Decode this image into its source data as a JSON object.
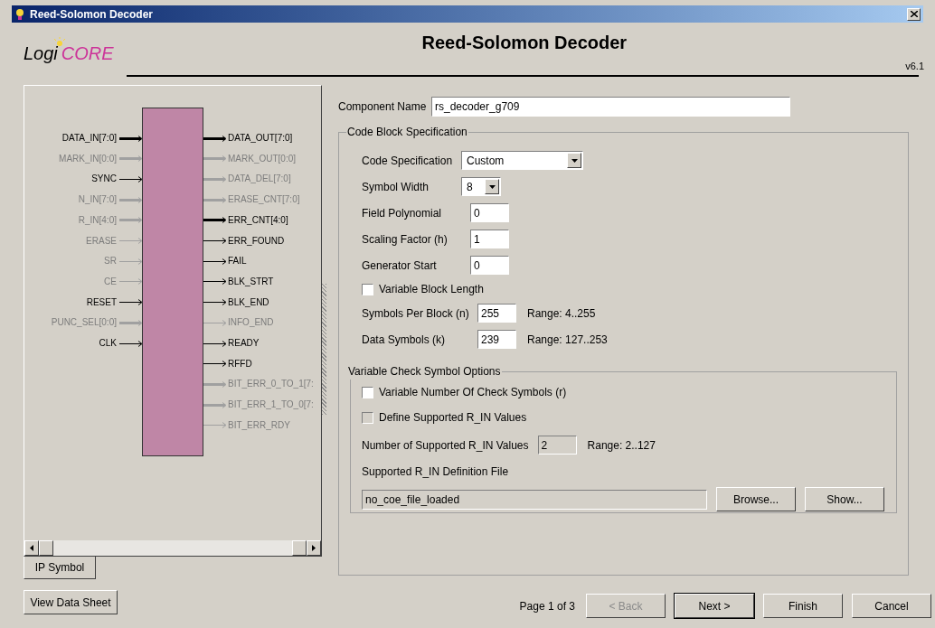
{
  "window": {
    "title": "Reed-Solomon Decoder"
  },
  "header": {
    "logo_prefix": "Logi",
    "logo_suffix": "CORE",
    "title": "Reed-Solomon Decoder",
    "version": "v6.1"
  },
  "symbol": {
    "inputs": [
      {
        "label": "DATA_IN[7:0]",
        "bus": true,
        "enabled": true
      },
      {
        "label": "MARK_IN[0:0]",
        "bus": true,
        "enabled": false
      },
      {
        "label": "SYNC",
        "bus": false,
        "enabled": true
      },
      {
        "label": "N_IN[7:0]",
        "bus": true,
        "enabled": false
      },
      {
        "label": "R_IN[4:0]",
        "bus": true,
        "enabled": false
      },
      {
        "label": "ERASE",
        "bus": false,
        "enabled": false
      },
      {
        "label": "SR",
        "bus": false,
        "enabled": false
      },
      {
        "label": "CE",
        "bus": false,
        "enabled": false
      },
      {
        "label": "RESET",
        "bus": false,
        "enabled": true
      },
      {
        "label": "PUNC_SEL[0:0]",
        "bus": true,
        "enabled": false
      },
      {
        "label": "CLK",
        "bus": false,
        "enabled": true
      }
    ],
    "outputs": [
      {
        "label": "DATA_OUT[7:0]",
        "bus": true,
        "enabled": true
      },
      {
        "label": "MARK_OUT[0:0]",
        "bus": true,
        "enabled": false
      },
      {
        "label": "DATA_DEL[7:0]",
        "bus": true,
        "enabled": false
      },
      {
        "label": "ERASE_CNT[7:0]",
        "bus": true,
        "enabled": false
      },
      {
        "label": "ERR_CNT[4:0]",
        "bus": true,
        "enabled": true
      },
      {
        "label": "ERR_FOUND",
        "bus": false,
        "enabled": true
      },
      {
        "label": "FAIL",
        "bus": false,
        "enabled": true
      },
      {
        "label": "BLK_STRT",
        "bus": false,
        "enabled": true
      },
      {
        "label": "BLK_END",
        "bus": false,
        "enabled": true
      },
      {
        "label": "INFO_END",
        "bus": false,
        "enabled": false
      },
      {
        "label": "READY",
        "bus": false,
        "enabled": true
      },
      {
        "label": "RFFD",
        "bus": false,
        "enabled": true
      },
      {
        "label": "BIT_ERR_0_TO_1[7:",
        "bus": true,
        "enabled": false
      },
      {
        "label": "BIT_ERR_1_TO_0[7:",
        "bus": true,
        "enabled": false
      },
      {
        "label": "BIT_ERR_RDY",
        "bus": false,
        "enabled": false
      }
    ]
  },
  "tabs": [
    {
      "label": "IP Symbol",
      "selected": true
    }
  ],
  "view_data_sheet": "View Data Sheet",
  "component_name": {
    "label": "Component Name",
    "value": "rs_decoder_g709"
  },
  "code_block": {
    "title": "Code Block Specification",
    "rows": [
      {
        "kind": "select",
        "label": "Code Specification",
        "value": "Custom",
        "wide": true,
        "enabled": true
      },
      {
        "kind": "select",
        "label": "Symbol Width",
        "value": "8",
        "wide": false,
        "enabled": true
      },
      {
        "kind": "text",
        "label": "Field Polynomial",
        "value": "0",
        "enabled": true
      },
      {
        "kind": "text",
        "label": "Scaling Factor (h)",
        "value": "1",
        "enabled": true
      },
      {
        "kind": "text",
        "label": "Generator Start",
        "value": "0",
        "enabled": true
      },
      {
        "kind": "checkbox",
        "label": "Variable Block Length",
        "checked": false,
        "enabled": true
      },
      {
        "kind": "text",
        "label": "Symbols Per Block (n)",
        "value": "255",
        "range": "Range: 4..255",
        "enabled": true
      },
      {
        "kind": "text",
        "label": "Data Symbols (k)",
        "value": "239",
        "range": "Range: 127..253",
        "enabled": true
      }
    ]
  },
  "check_symbols": {
    "title": "Variable Check Symbol Options",
    "rows": [
      {
        "kind": "checkbox",
        "label": "Variable Number Of Check Symbols (r)",
        "checked": false,
        "enabled": true
      },
      {
        "kind": "checkbox",
        "label": "Define Supported R_IN Values",
        "checked": false,
        "enabled": false
      },
      {
        "kind": "text",
        "label": "Number of Supported R_IN Values",
        "value": "2",
        "range": "Range: 2..127",
        "enabled": false
      }
    ],
    "file_label": "Supported R_IN Definition File",
    "file_value": "no_coe_file_loaded",
    "buttons": [
      "Browse...",
      "Show..."
    ]
  },
  "footer": {
    "page": "Page 1 of 3",
    "buttons": [
      {
        "label": "< Back",
        "enabled": false
      },
      {
        "label": "Next >",
        "enabled": true
      },
      {
        "label": "Finish",
        "enabled": true
      },
      {
        "label": "Cancel",
        "enabled": true
      }
    ]
  }
}
